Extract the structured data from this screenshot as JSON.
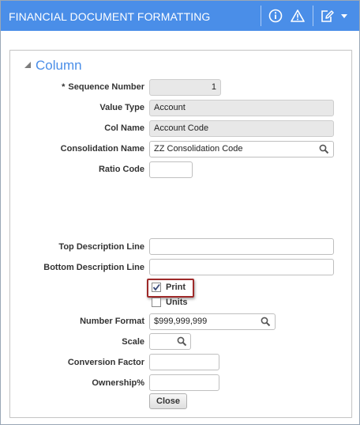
{
  "window": {
    "title": "FINANCIAL DOCUMENT FORMATTING"
  },
  "section": {
    "title": "Column"
  },
  "form": {
    "required_marker": "*",
    "sequence_number_label": "Sequence Number",
    "sequence_number_value": "1",
    "value_type_label": "Value Type",
    "value_type_value": "Account",
    "col_name_label": "Col Name",
    "col_name_value": "Account Code",
    "consolidation_name_label": "Consolidation Name",
    "consolidation_name_value": "ZZ Consolidation Code",
    "ratio_code_label": "Ratio Code",
    "ratio_code_value": "",
    "top_description_label": "Top Description Line",
    "top_description_value": "",
    "bottom_description_label": "Bottom Description Line",
    "bottom_description_value": "",
    "print_label": "Print",
    "print_checked": true,
    "units_label": "Units",
    "units_checked": false,
    "number_format_label": "Number Format",
    "number_format_value": "$999,999,999",
    "scale_label": "Scale",
    "scale_value": "",
    "conversion_factor_label": "Conversion Factor",
    "conversion_factor_value": "",
    "ownership_label": "Ownership%",
    "ownership_value": "",
    "close_label": "Close"
  },
  "colors": {
    "titlebar": "#4a8ee8",
    "section_title": "#4a8ee8",
    "highlight_border": "#9e2a2a"
  },
  "icons": {
    "info": "info-icon",
    "warning": "warning-icon",
    "edit": "edit-icon",
    "dropdown": "chevron-down-icon",
    "collapse": "collapse-triangle-icon",
    "lookup": "search-icon"
  }
}
